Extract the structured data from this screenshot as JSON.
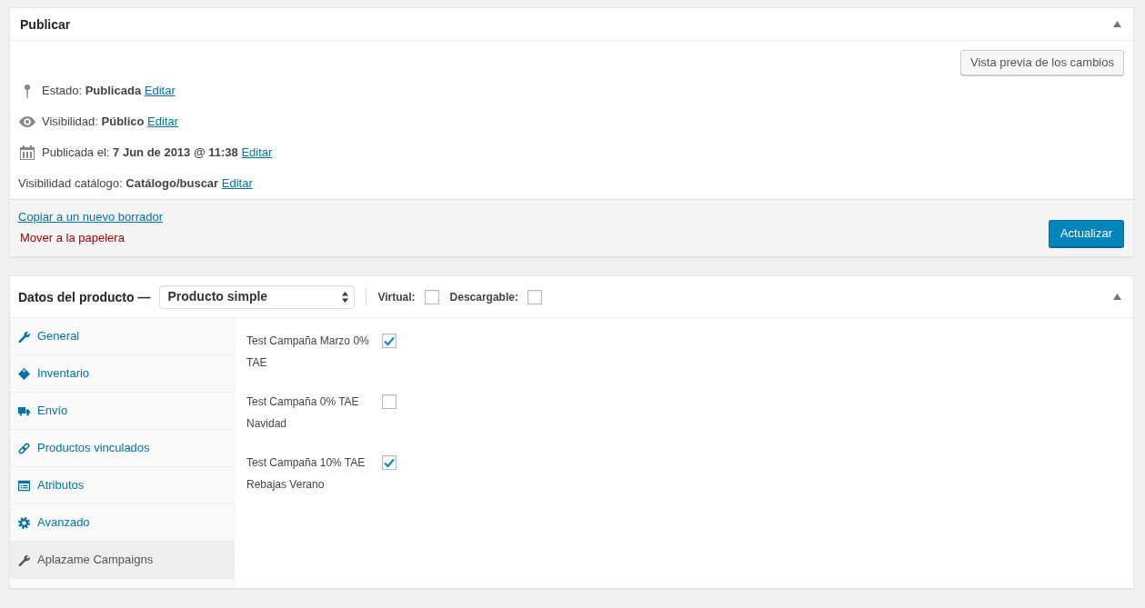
{
  "publish_box": {
    "title": "Publicar",
    "preview_button": "Vista previa de los cambios",
    "fields": [
      {
        "kind": "pin",
        "label": "Estado:",
        "value": "Publicada",
        "link": "Editar"
      },
      {
        "kind": "eye",
        "label": "Visibilidad:",
        "value": "Público",
        "link": "Editar"
      },
      {
        "kind": "calendar",
        "label": "Publicada el:",
        "value": "7 Jun de 2013 @ 11:38",
        "link": "Editar"
      },
      {
        "kind": "plain",
        "label": "Visibilidad catálogo:",
        "value": "Catálogo/buscar",
        "link": "Editar"
      }
    ],
    "copy_link": "Copiar a un nuevo borrador",
    "trash_link": "Mover a la papelera",
    "update_button": "Actualizar"
  },
  "product_data": {
    "title": "Datos del producto —",
    "product_type": "Producto simple",
    "options": [
      {
        "label": "Virtual:",
        "checked": false
      },
      {
        "label": "Descargable:",
        "checked": false
      }
    ],
    "tabs": [
      {
        "kind": "wrench",
        "label": "General",
        "selected": false
      },
      {
        "kind": "tag",
        "label": "Inventario",
        "selected": false
      },
      {
        "kind": "truck",
        "label": "Envío",
        "selected": false
      },
      {
        "kind": "link",
        "label": "Productos vinculados",
        "selected": false
      },
      {
        "kind": "list",
        "label": "Atributos",
        "selected": false
      },
      {
        "kind": "gear",
        "label": "Avanzado",
        "selected": false
      },
      {
        "kind": "wrench",
        "label": "Aplazame Campaigns",
        "selected": true
      }
    ],
    "campaigns": [
      {
        "label": "Test Campaña Marzo 0% TAE",
        "checked": true
      },
      {
        "label": "Test Campaña 0% TAE Navidad",
        "checked": false
      },
      {
        "label": "Test Campaña 10% TAE Rebajas Verano",
        "checked": true
      }
    ]
  }
}
